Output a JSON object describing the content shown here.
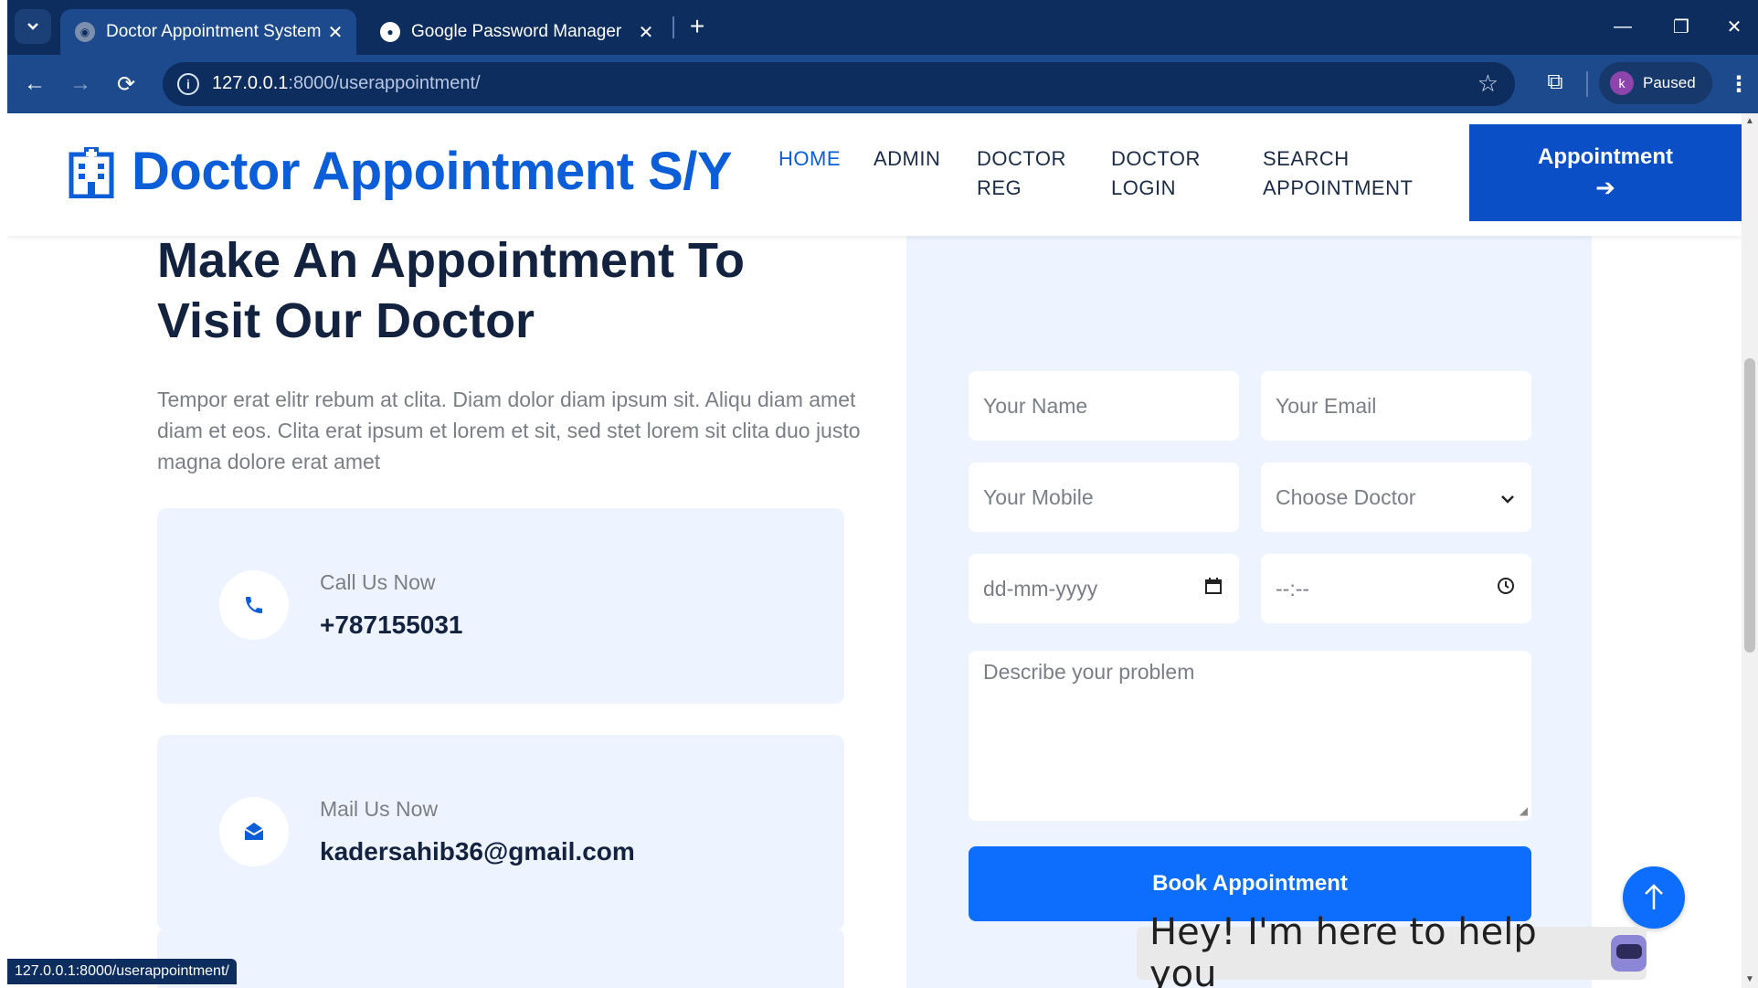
{
  "browser": {
    "tabs": [
      {
        "title": "Doctor Appointment System",
        "active": true
      },
      {
        "title": "Google Password Manager",
        "active": false
      }
    ],
    "url_host": "127.0.0.1",
    "url_rest": ":8000/userappointment/",
    "profile_initial": "k",
    "profile_status": "Paused",
    "status_bar_url": "127.0.0.1:8000/userappointment/"
  },
  "site": {
    "brand": "Doctor Appointment S/Y",
    "nav": {
      "home": "HOME",
      "admin": "ADMIN",
      "doctor_reg_1": "DOCTOR",
      "doctor_reg_2": "REG",
      "doctor_login_1": "DOCTOR",
      "doctor_login_2": "LOGIN",
      "search_1": "SEARCH",
      "search_2": "APPOINTMENT"
    },
    "appointment_button": "Appointment",
    "accent_color": "#0b5ed7"
  },
  "content": {
    "heading_line1": "Make An Appointment To",
    "heading_line2": "Visit Our Doctor",
    "paragraph": "Tempor erat elitr rebum at clita. Diam dolor diam ipsum sit. Aliqu diam amet diam et eos. Clita erat ipsum et lorem et sit, sed stet lorem sit clita duo justo magna dolore erat amet",
    "call_label": "Call Us Now",
    "call_value": "+787155031",
    "mail_label": "Mail Us Now",
    "mail_value": "kadersahib36@gmail.com"
  },
  "form": {
    "name_placeholder": "Your Name",
    "email_placeholder": "Your Email",
    "mobile_placeholder": "Your Mobile",
    "doctor_select": "Choose Doctor",
    "date_placeholder": "dd-mm-yyyy",
    "time_placeholder": "--:--",
    "problem_placeholder": "Describe your problem",
    "submit_label": "Book Appointment"
  },
  "chat": {
    "message": "Hey! I'm here to help you"
  }
}
